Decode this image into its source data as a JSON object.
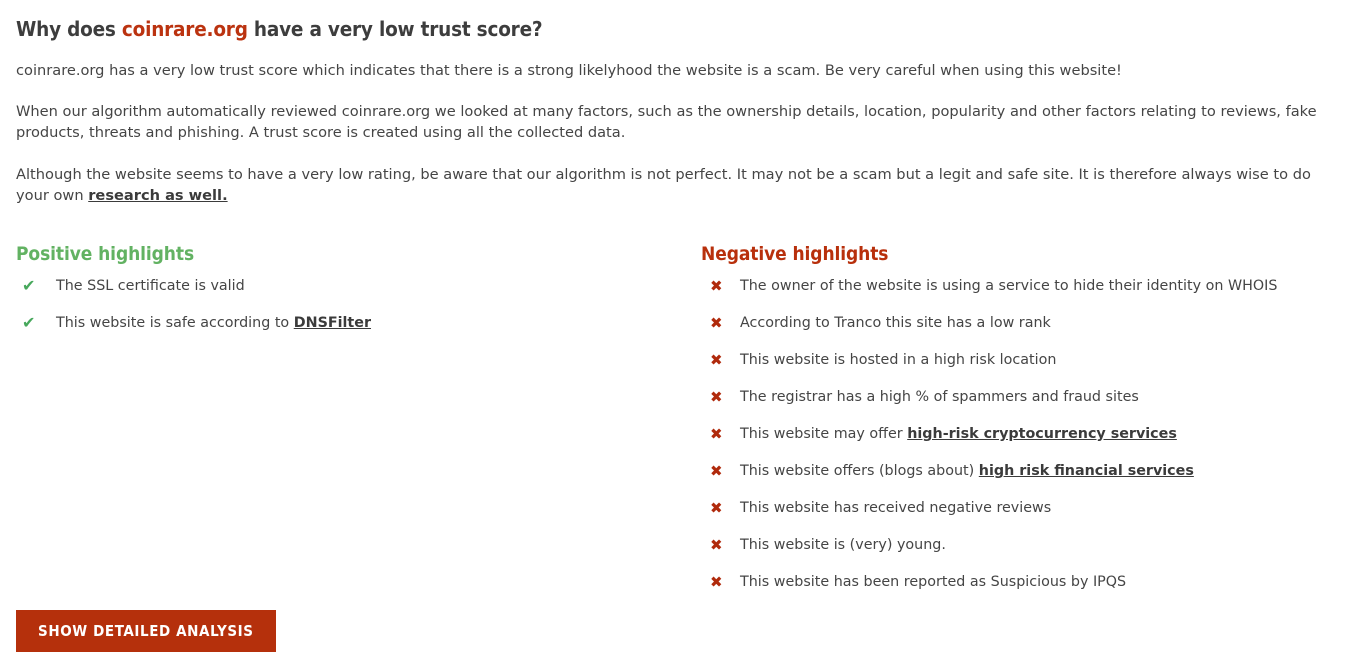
{
  "heading": {
    "prefix": "Why does ",
    "domain": "coinrare.org",
    "suffix": " have a very low trust score?"
  },
  "intro": {
    "p1": "coinrare.org has a very low trust score which indicates that there is a strong likelyhood the website is a scam. Be very careful when using this website!",
    "p2": "When our algorithm automatically reviewed coinrare.org we looked at many factors, such as the ownership details, location, popularity and other factors relating to reviews, fake products, threats and phishing. A trust score is created using all the collected data.",
    "p3_before_link": "Although the website seems to have a very low rating, be aware that our algorithm is not perfect. It may not be a scam but a legit and safe site. It is therefore always wise to do your own ",
    "p3_link": "research as well."
  },
  "positive": {
    "title": "Positive highlights",
    "icon": "check-icon",
    "icon_glyph": "✔",
    "items": [
      {
        "text": "The SSL certificate is valid",
        "link": ""
      },
      {
        "text": "This website is safe according to ",
        "link": "DNSFilter"
      }
    ]
  },
  "negative": {
    "title": "Negative highlights",
    "icon": "cross-icon",
    "icon_glyph": "✖",
    "items": [
      {
        "text": "The owner of the website is using a service to hide their identity on WHOIS",
        "link": ""
      },
      {
        "text": "According to Tranco this site has a low rank",
        "link": ""
      },
      {
        "text": "This website is hosted in a high risk location",
        "link": ""
      },
      {
        "text": "The registrar has a high % of spammers and fraud sites",
        "link": ""
      },
      {
        "text": "This website may offer ",
        "link": "high-risk cryptocurrency services"
      },
      {
        "text": "This website offers (blogs about) ",
        "link": "high risk financial services"
      },
      {
        "text": "This website has received negative reviews",
        "link": ""
      },
      {
        "text": "This website is (very) young.",
        "link": ""
      },
      {
        "text": "This website has been reported as Suspicious by IPQS",
        "link": ""
      }
    ]
  },
  "cta": {
    "label": "Show detailed analysis"
  },
  "colors": {
    "accent_red": "#bb3310",
    "button_red": "#b5300c",
    "positive_green": "#62b262",
    "check_green": "#47a85c",
    "cross_red": "#b02a0c",
    "body_text": "#454545"
  }
}
